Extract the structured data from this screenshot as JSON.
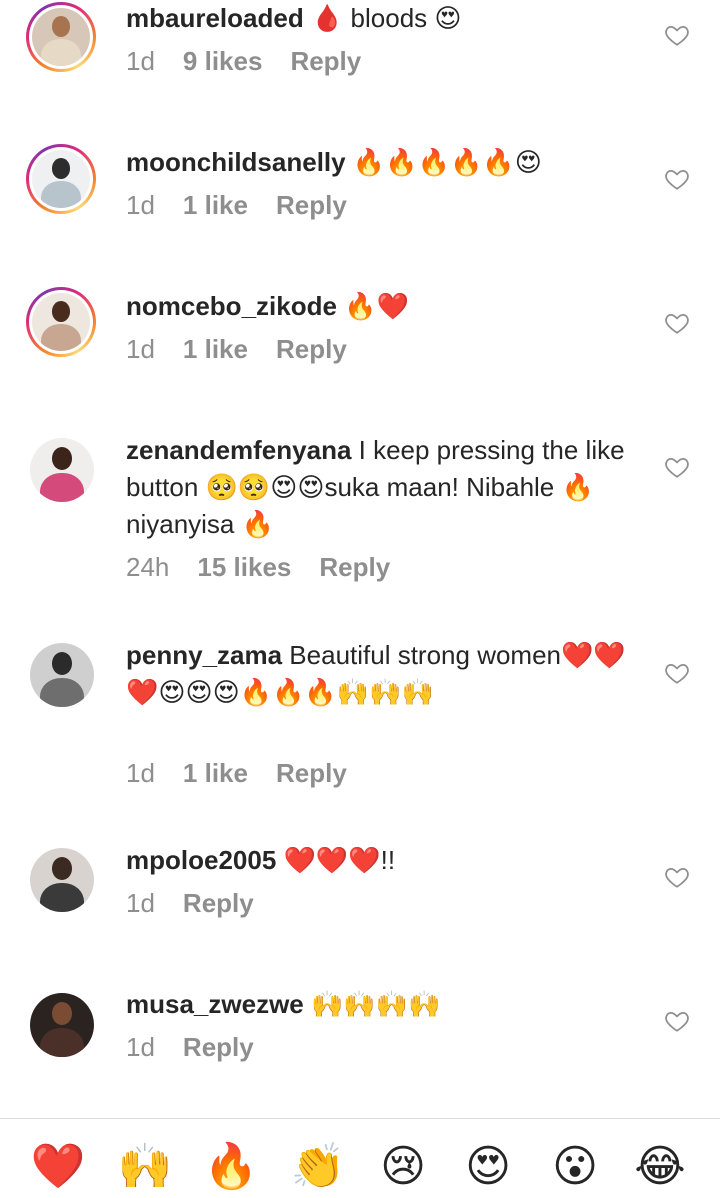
{
  "comments": [
    {
      "username": "mbaureloaded",
      "text": "🩸 bloods 😍",
      "time": "1d",
      "likes": "9 likes",
      "reply": "Reply",
      "avatar": {
        "ring": true,
        "bg": "#d7c7b8",
        "head": "#a8744f",
        "body": "#e6d9c6"
      }
    },
    {
      "username": "moonchildsanelly",
      "text": "🔥🔥🔥🔥🔥😍",
      "time": "1d",
      "likes": "1 like",
      "reply": "Reply",
      "avatar": {
        "ring": true,
        "bg": "#eef0f2",
        "head": "#2d2d2d",
        "body": "#b7c4cc"
      }
    },
    {
      "username": "nomcebo_zikode",
      "text": "🔥❤️",
      "time": "1d",
      "likes": "1 like",
      "reply": "Reply",
      "avatar": {
        "ring": true,
        "bg": "#ede7e0",
        "head": "#4a2c1e",
        "body": "#c7a792"
      }
    },
    {
      "username": "zenandemfenyana",
      "text": "I keep pressing the like button 🥺🥺😍😍suka maan! Nibahle 🔥 niyanyisa 🔥",
      "time": "24h",
      "likes": "15 likes",
      "reply": "Reply",
      "avatar": {
        "ring": false,
        "bg": "#f0eded",
        "head": "#3b241a",
        "body": "#d44a7a"
      }
    },
    {
      "username": "penny_zama",
      "text": "Beautiful strong women❤️❤️❤️😍😍😍🔥🔥🔥🙌🙌🙌",
      "time": "1d",
      "likes": "1 like",
      "reply": "Reply",
      "avatar": {
        "ring": false,
        "bg": "#cfcfcf",
        "head": "#2b2b2b",
        "body": "#6e6e6e"
      }
    },
    {
      "username": "mpoloe2005",
      "text": "❤️❤️❤️!!",
      "time": "1d",
      "likes": "",
      "reply": "Reply",
      "avatar": {
        "ring": false,
        "bg": "#d9d3d0",
        "head": "#3a2a22",
        "body": "#3a3a3a"
      }
    },
    {
      "username": "musa_zwezwe",
      "text": "🙌🙌🙌🙌",
      "time": "1d",
      "likes": "",
      "reply": "Reply",
      "avatar": {
        "ring": false,
        "bg": "#2a2320",
        "head": "#7a4c34",
        "body": "#4a3028"
      }
    }
  ],
  "reactions": [
    {
      "name": "red-heart",
      "glyph": "❤️"
    },
    {
      "name": "raising-hands",
      "glyph": "🙌"
    },
    {
      "name": "fire",
      "glyph": "🔥"
    },
    {
      "name": "clapping-hands",
      "glyph": "👏"
    },
    {
      "name": "sad-face",
      "glyph": "😢"
    },
    {
      "name": "heart-eyes",
      "glyph": "😍"
    },
    {
      "name": "surprised-face",
      "glyph": "😮"
    },
    {
      "name": "tears-of-joy",
      "glyph": "😂"
    }
  ]
}
